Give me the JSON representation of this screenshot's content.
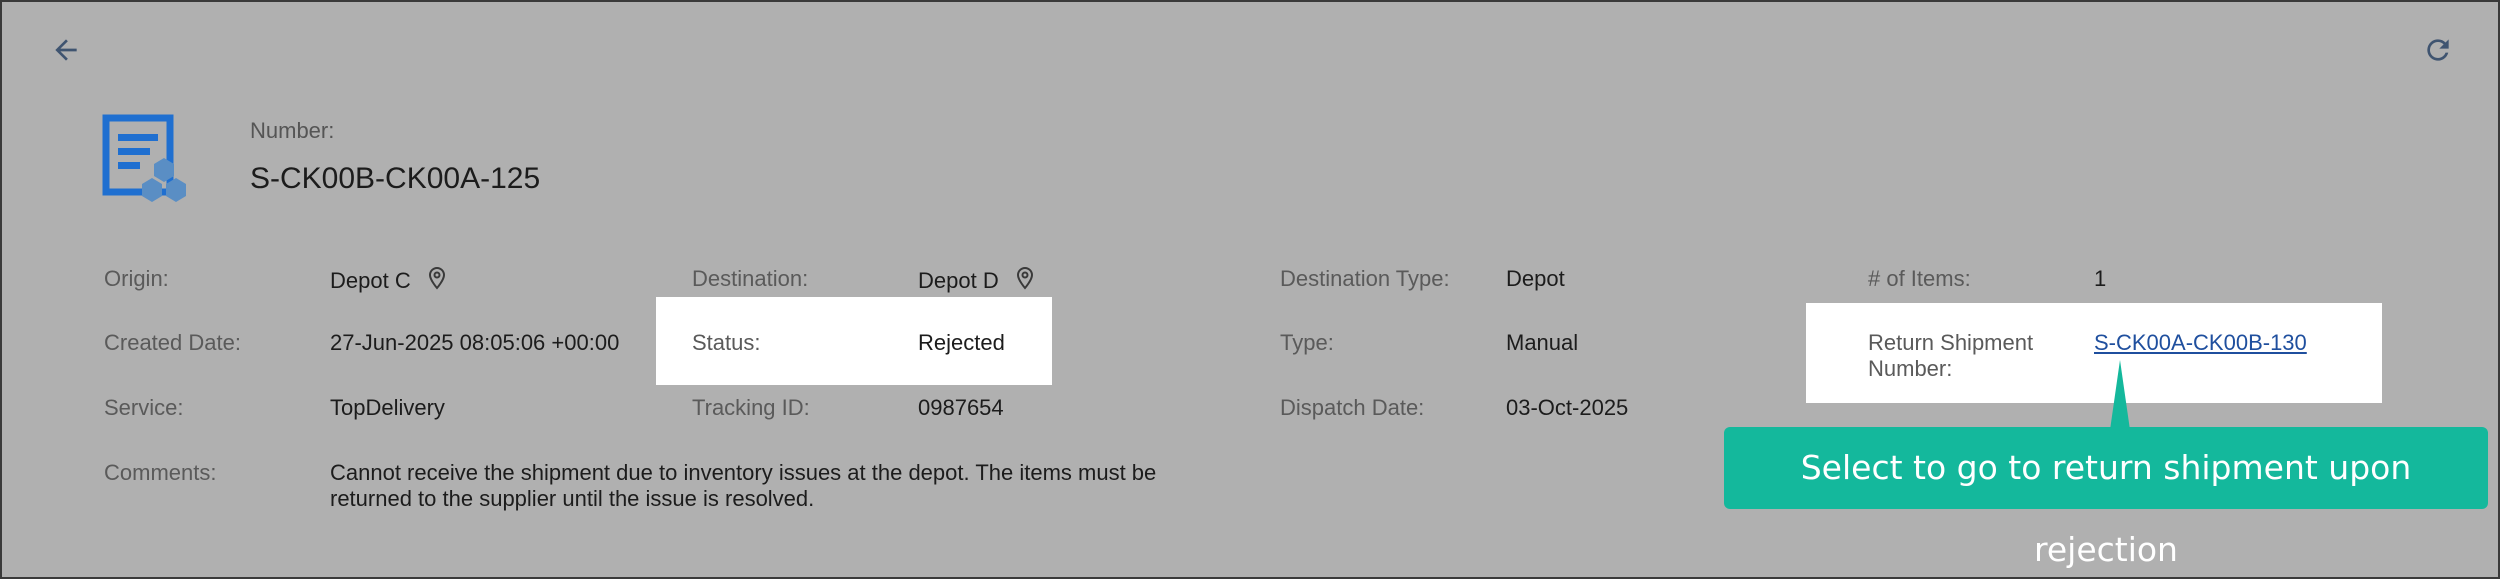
{
  "header": {
    "number_label": "Number:",
    "number_value": "S-CK00B-CK00A-125"
  },
  "icons": {
    "back": "arrow-left-icon",
    "refresh": "refresh-icon",
    "document": "shipment-document-icon",
    "location": "location-pin-icon"
  },
  "fields": {
    "origin": {
      "label": "Origin:",
      "value": "Depot C"
    },
    "destination": {
      "label": "Destination:",
      "value": "Depot D"
    },
    "destination_type": {
      "label": "Destination Type:",
      "value": "Depot"
    },
    "num_items": {
      "label": "# of Items:",
      "value": "1"
    },
    "created_date": {
      "label": "Created Date:",
      "value": "27-Jun-2025 08:05:06 +00:00"
    },
    "status": {
      "label": "Status:",
      "value": "Rejected"
    },
    "type": {
      "label": "Type:",
      "value": "Manual"
    },
    "return_shipment": {
      "label": "Return Shipment Number:",
      "value": "S-CK00A-CK00B-130"
    },
    "service": {
      "label": "Service:",
      "value": "TopDelivery"
    },
    "tracking_id": {
      "label": "Tracking ID:",
      "value": "0987654"
    },
    "dispatch_date": {
      "label": "Dispatch Date:",
      "value": "03-Oct-2025"
    },
    "comments": {
      "label": "Comments:",
      "value": "Cannot receive the shipment due to inventory issues at the depot. The items must be returned to the supplier until the issue is resolved."
    }
  },
  "callout": {
    "text": "Select to go to return shipment upon rejection"
  },
  "colors": {
    "overlay": "#b0b0b0",
    "accent_callout": "#14b89c",
    "icon_blue": "#1f6fd0",
    "link": "#1f4f9e"
  }
}
